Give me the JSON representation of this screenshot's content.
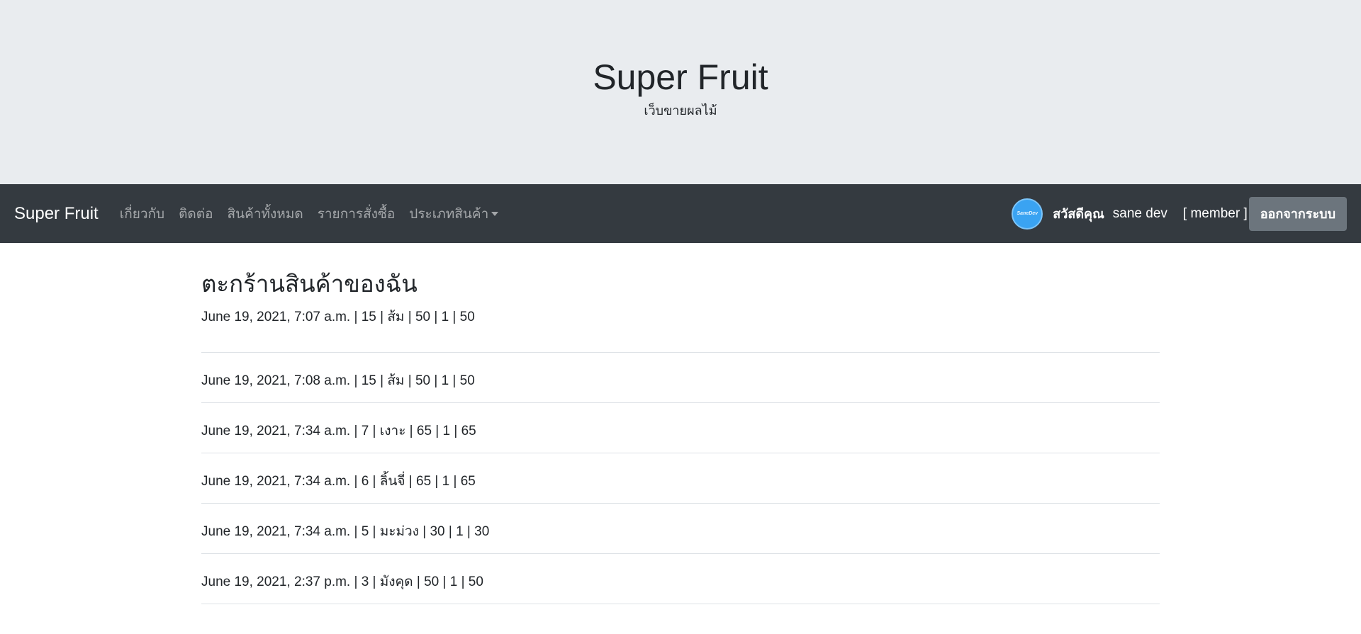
{
  "hero": {
    "title": "Super Fruit",
    "subtitle": "เว็บขายผลไม้"
  },
  "navbar": {
    "brand": "Super Fruit",
    "links": [
      {
        "label": "เกี่ยวกับ"
      },
      {
        "label": "ติดต่อ"
      },
      {
        "label": "สินค้าทั้งหมด"
      },
      {
        "label": "รายการสั่งซื้อ"
      },
      {
        "label": "ประเภทสินค้า",
        "dropdown": true
      }
    ],
    "user": {
      "avatar_text": "SaneDev",
      "greeting": "สวัสดีคุณ",
      "name": "sane dev",
      "role": "[ member ]",
      "logout_label": "ออกจากระบบ"
    }
  },
  "main": {
    "heading": "ตะกร้านสินค้าของฉัน",
    "orders": [
      "June 19, 2021, 7:07 a.m. | 15 | ส้ม | 50 | 1 | 50",
      "June 19, 2021, 7:08 a.m. | 15 | ส้ม | 50 | 1 | 50",
      "June 19, 2021, 7:34 a.m. | 7 | เงาะ | 65 | 1 | 65",
      "June 19, 2021, 7:34 a.m. | 6 | ลิ้นจี่ | 65 | 1 | 65",
      "June 19, 2021, 7:34 a.m. | 5 | มะม่วง | 30 | 1 | 30",
      "June 19, 2021, 2:37 p.m. | 3 | มังคุด | 50 | 1 | 50"
    ]
  },
  "colors": {
    "hero_bg": "#e9ecef",
    "navbar_bg": "#343a40",
    "logout_bg": "#6c757d",
    "avatar_bg": "#3aa3f2"
  }
}
